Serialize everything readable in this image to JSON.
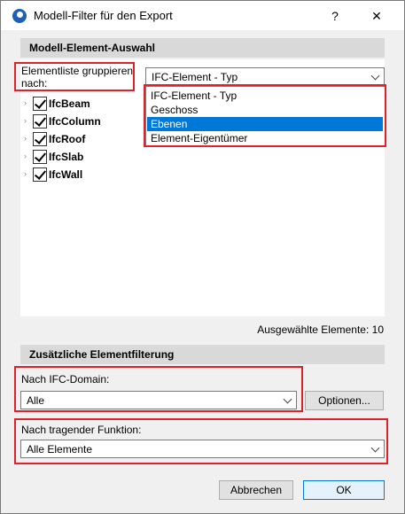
{
  "window": {
    "title": "Modell-Filter für den Export",
    "help": "?",
    "close": "✕"
  },
  "section1": {
    "header": "Modell-Element-Auswahl"
  },
  "group": {
    "label_line1": "Elementliste gruppieren",
    "label_line2": "nach:",
    "selected": "IFC-Element - Typ",
    "options": [
      "IFC-Element - Typ",
      "Geschoss",
      "Ebenen",
      "Element-Eigentümer"
    ],
    "highlighted_option": "Ebenen"
  },
  "tree": {
    "items": [
      "IfcBeam",
      "IfcColumn",
      "IfcRoof",
      "IfcSlab",
      "IfcWall"
    ]
  },
  "selected_count": "Ausgewählte Elemente: 10",
  "section2": {
    "header": "Zusätzliche Elementfilterung"
  },
  "domain": {
    "label": "Nach IFC-Domain:",
    "value": "Alle",
    "options_button": "Optionen..."
  },
  "function": {
    "label": "Nach tragender Funktion:",
    "value": "Alle Elemente"
  },
  "buttons": {
    "cancel": "Abbrechen",
    "ok": "OK"
  },
  "colors": {
    "highlight": "#0078d7",
    "annotation_red": "#e0202a",
    "section_header": "#d9d9d9"
  }
}
